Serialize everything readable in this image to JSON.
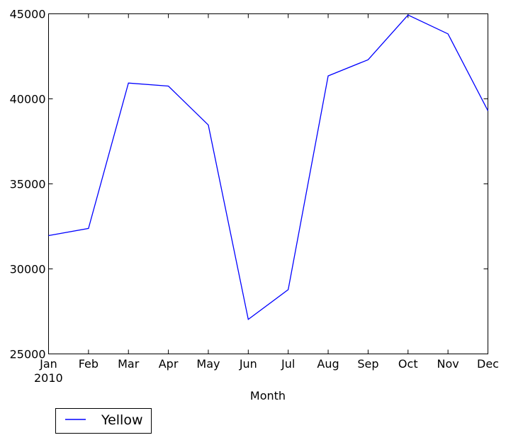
{
  "chart_data": {
    "type": "line",
    "title": "",
    "xlabel": "Month",
    "ylabel": "",
    "categories": [
      "Jan",
      "Feb",
      "Mar",
      "Apr",
      "May",
      "Jun",
      "Jul",
      "Aug",
      "Sep",
      "Oct",
      "Nov",
      "Dec"
    ],
    "year_label": "2010",
    "series": [
      {
        "name": "Yellow",
        "color": "#0000ff",
        "values": [
          31960,
          32380,
          40930,
          40750,
          38460,
          27030,
          28780,
          41350,
          42300,
          44930,
          43820,
          39300
        ]
      }
    ],
    "ylim": [
      25000,
      45000
    ],
    "yticks": [
      25000,
      30000,
      35000,
      40000,
      45000
    ],
    "ytick_labels": [
      "25000",
      "30000",
      "35000",
      "40000",
      "45000"
    ],
    "grid": false,
    "legend": {
      "placement": "below-left",
      "entries": [
        "Yellow"
      ]
    }
  }
}
